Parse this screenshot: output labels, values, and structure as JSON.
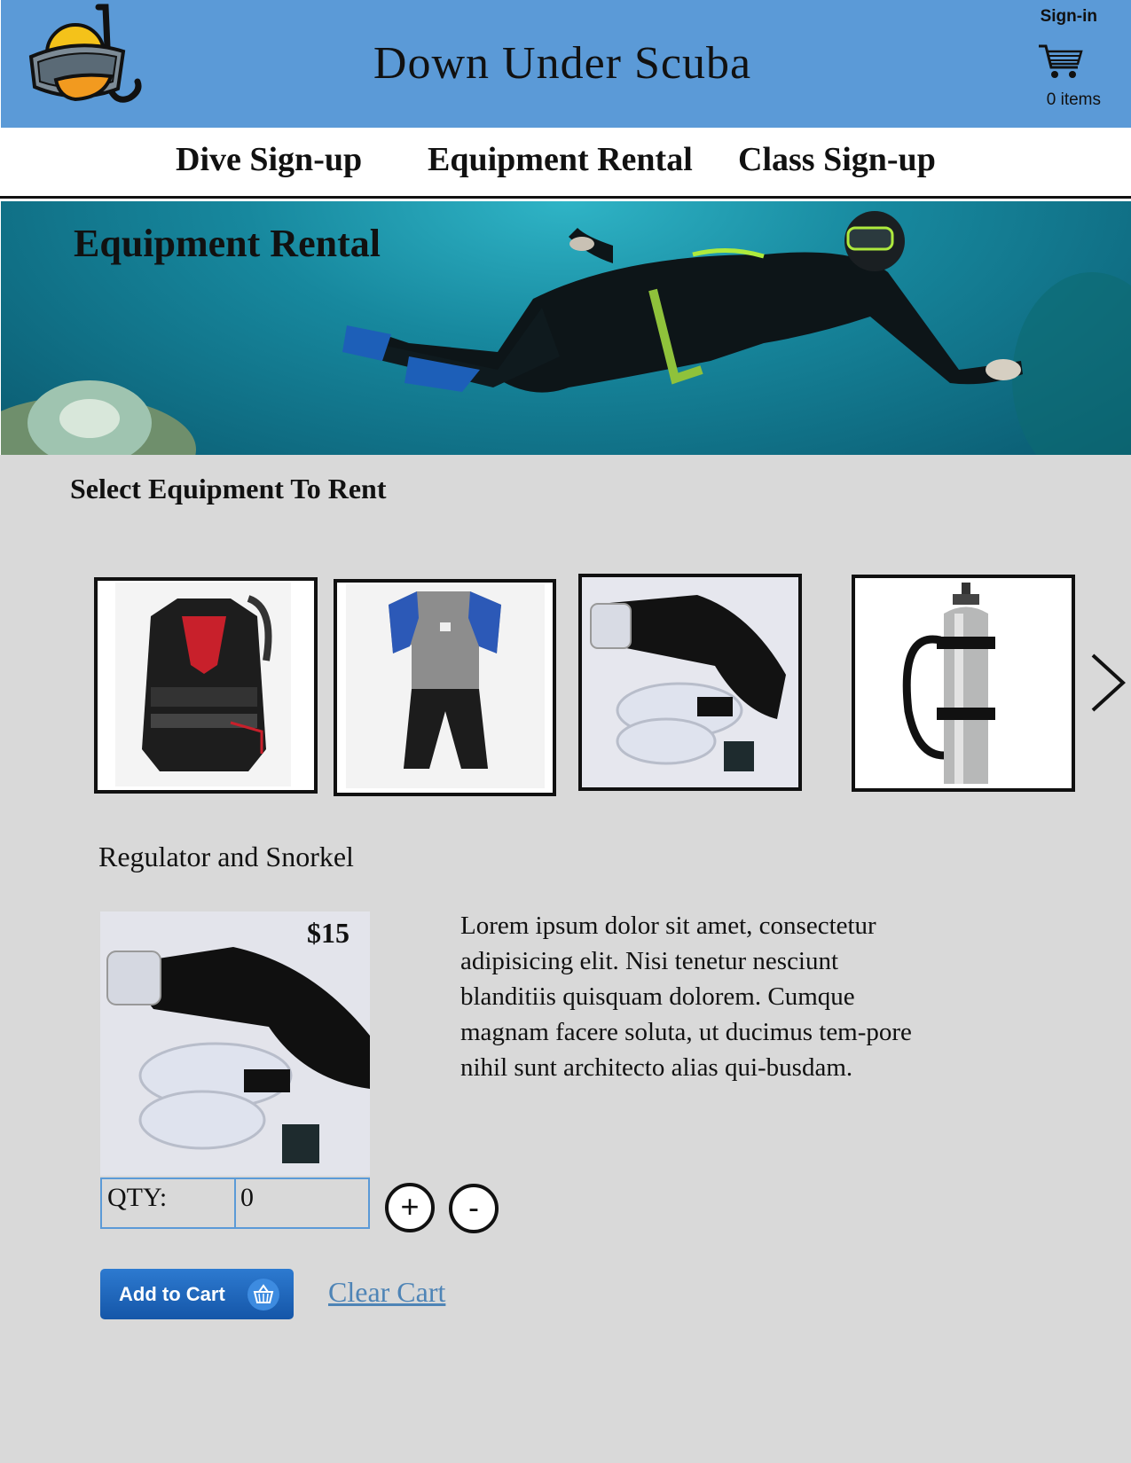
{
  "header": {
    "site_title": "Down Under Scuba",
    "signin_label": "Sign-in",
    "cart_count": "0 items",
    "bg_color": "#5b9ad7"
  },
  "nav": {
    "items": [
      {
        "label": "Dive Sign-up"
      },
      {
        "label": "Equipment Rental"
      },
      {
        "label": "Class Sign-up"
      }
    ]
  },
  "hero": {
    "title": "Equipment Rental"
  },
  "main": {
    "section_title": "Select Equipment To Rent",
    "thumbnails": [
      {
        "icon": "bcd-vest-image"
      },
      {
        "icon": "wetsuit-image"
      },
      {
        "icon": "regulator-snorkel-image"
      },
      {
        "icon": "scuba-tank-image"
      }
    ],
    "next_icon": "chevron-right-icon",
    "product": {
      "name": "Regulator and Snorkel",
      "price": "$15",
      "description": "Lorem ipsum dolor sit amet, consectetur adipisicing elit. Nisi tenetur nesciunt blanditiis quisquam dolorem. Cumque magnam facere soluta, ut ducimus tem-pore nihil sunt architecto alias qui-busdam."
    },
    "qty": {
      "label": "QTY:",
      "value": "0",
      "plus_label": "+",
      "minus_label": "-"
    },
    "add_to_cart_label": "Add to Cart",
    "clear_cart_label": "Clear Cart",
    "accent_color": "#1a63b8"
  }
}
